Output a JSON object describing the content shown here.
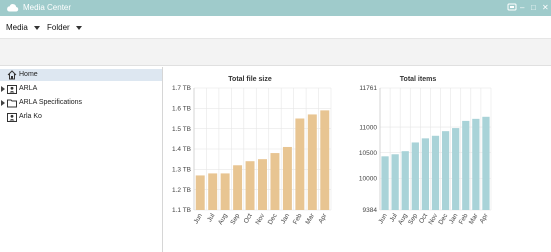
{
  "window": {
    "title": "Media Center",
    "controls": {
      "minimize": "–",
      "maximize": "□",
      "close": "✕"
    }
  },
  "menubar": {
    "items": [
      {
        "label": "Media"
      },
      {
        "label": "Folder"
      }
    ]
  },
  "sidebar": {
    "items": [
      {
        "label": "Home",
        "icon": "home-icon",
        "selected": true,
        "expandable": false
      },
      {
        "label": "ARLA",
        "icon": "user-folder-icon",
        "selected": false,
        "expandable": true
      },
      {
        "label": "ARLA Specifications",
        "icon": "folder-icon",
        "selected": false,
        "expandable": true
      },
      {
        "label": "Arla Ko",
        "icon": "user-folder-icon",
        "selected": false,
        "expandable": false
      }
    ]
  },
  "colors": {
    "titlebar": "#9fcbcb",
    "size_bar": "#e8c592",
    "items_bar": "#a9d3d8",
    "selected_row": "#dde7f1"
  },
  "chart_data": [
    {
      "type": "bar",
      "title": "Total file size",
      "categories": [
        "Jun",
        "Jul",
        "Aug",
        "Sep",
        "Oct",
        "Nov",
        "Dec",
        "Jan",
        "Feb",
        "Mar",
        "Apr"
      ],
      "values": [
        1.27,
        1.28,
        1.28,
        1.32,
        1.34,
        1.35,
        1.38,
        1.41,
        1.55,
        1.57,
        1.59
      ],
      "unit": "TB",
      "ylim": [
        1.1,
        1.7
      ],
      "yticks": [
        "1.1 TB",
        "1.2 TB",
        "1.3 TB",
        "1.4 TB",
        "1.5 TB",
        "1.6 TB",
        "1.7 TB"
      ],
      "ytick_values": [
        1.1,
        1.2,
        1.3,
        1.4,
        1.5,
        1.6,
        1.7
      ],
      "grid": true
    },
    {
      "type": "bar",
      "title": "Total items",
      "categories": [
        "Jun",
        "Jul",
        "Aug",
        "Sep",
        "Oct",
        "Nov",
        "Dec",
        "Jan",
        "Feb",
        "Mar",
        "Apr"
      ],
      "values": [
        10430,
        10470,
        10530,
        10700,
        10780,
        10830,
        10920,
        10980,
        11120,
        11160,
        11200
      ],
      "ylim": [
        9384,
        11761
      ],
      "yticks": [
        "9384",
        "10000",
        "10500",
        "11000",
        "11761"
      ],
      "ytick_values": [
        9384,
        10000,
        10500,
        11000,
        11761
      ],
      "grid": true
    }
  ]
}
